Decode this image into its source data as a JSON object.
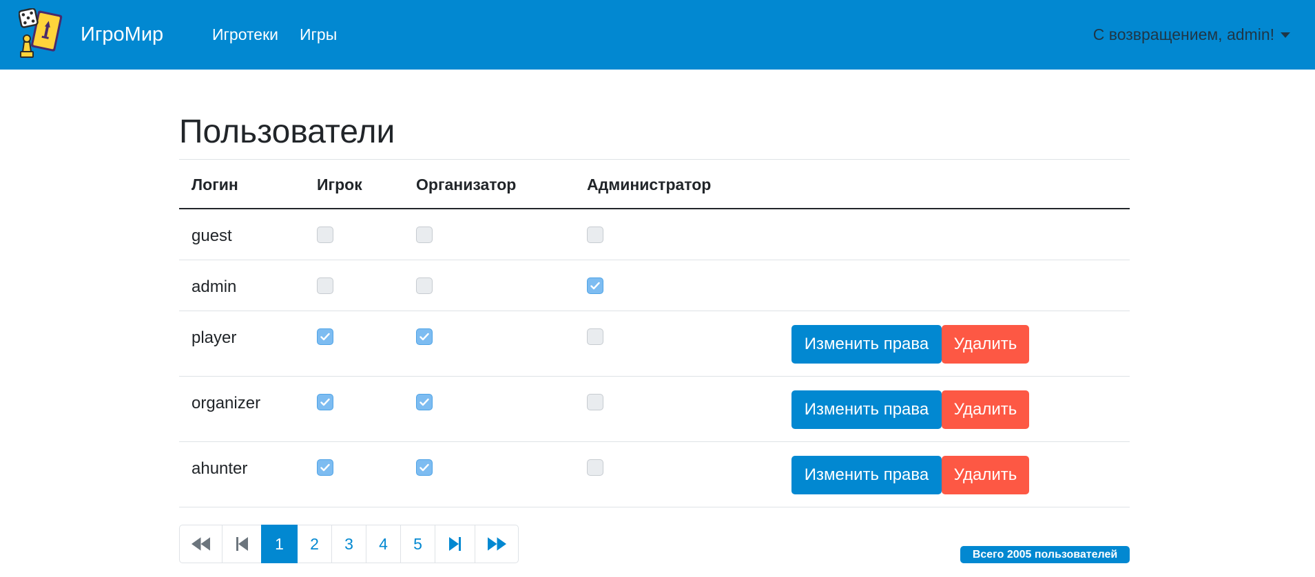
{
  "navbar": {
    "brand": "ИгроМир",
    "logo_icon": "board-games-logo-icon",
    "links": [
      "Игротеки",
      "Игры"
    ],
    "user_greeting": "С возвращением, admin!"
  },
  "page": {
    "title": "Пользователи"
  },
  "table": {
    "headers": [
      "Логин",
      "Игрок",
      "Организатор",
      "Администратор"
    ],
    "rows": [
      {
        "login": "guest",
        "player": false,
        "organizer": false,
        "admin": false
      },
      {
        "login": "admin",
        "player": false,
        "organizer": false,
        "admin": true
      },
      {
        "login": "player",
        "player": true,
        "organizer": true,
        "admin": false
      },
      {
        "login": "organizer",
        "player": true,
        "organizer": true,
        "admin": false
      },
      {
        "login": "ahunter",
        "player": true,
        "organizer": true,
        "admin": false
      }
    ]
  },
  "actions": {
    "edit_label": "Изменить права",
    "delete_label": "Удалить"
  },
  "pagination": {
    "first_icon": "fast-backward-icon",
    "prev_icon": "step-backward-icon",
    "pages": [
      "1",
      "2",
      "3",
      "4",
      "5"
    ],
    "active_page": "1",
    "next_icon": "step-forward-icon",
    "last_icon": "fast-forward-icon"
  },
  "total_badge": "Всего 2005 пользователей",
  "colors": {
    "accent": "#0288d1",
    "danger": "#fd5844",
    "disabled": "#6c757d"
  }
}
